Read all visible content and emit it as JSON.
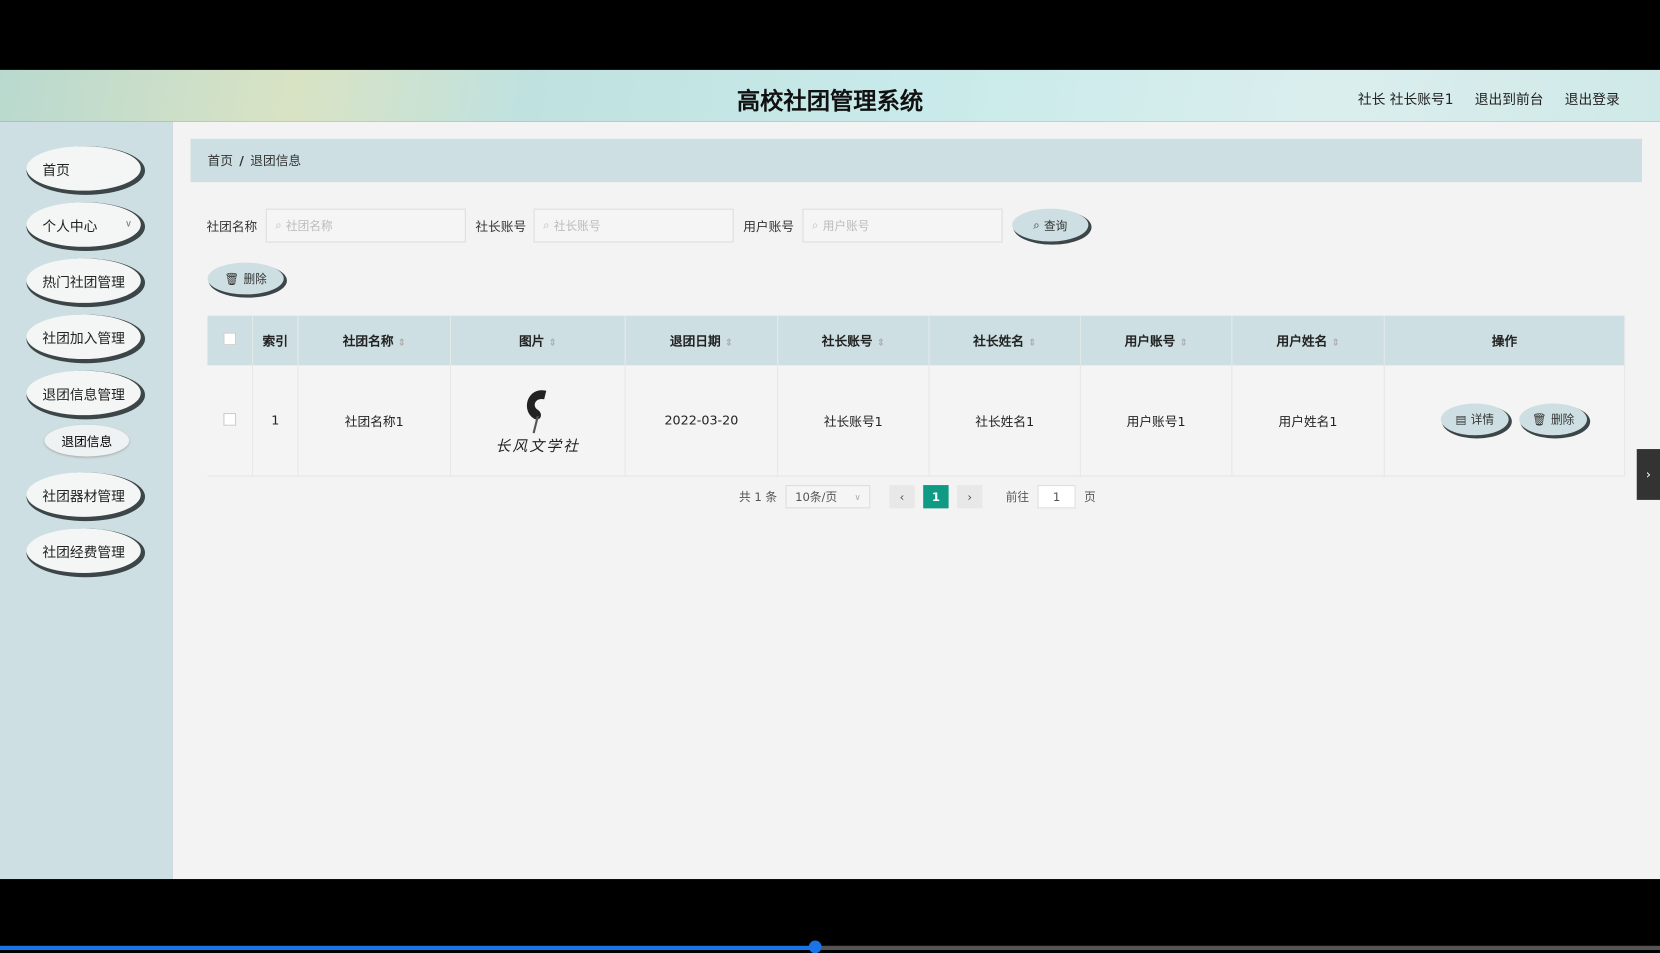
{
  "header": {
    "title": "高校社团管理系统",
    "user": "社长 社长账号1",
    "front": "退出到前台",
    "logout": "退出登录"
  },
  "sidebar": {
    "items": [
      "首页",
      "个人中心",
      "热门社团管理",
      "社团加入管理",
      "退团信息管理",
      "社团器材管理",
      "社团经费管理"
    ],
    "sub": "退团信息"
  },
  "breadcrumb": {
    "home": "首页",
    "sep": "/",
    "current": "退团信息"
  },
  "search": {
    "f1_label": "社团名称",
    "f1_ph": "社团名称",
    "f2_label": "社长账号",
    "f2_ph": "社长账号",
    "f3_label": "用户账号",
    "f3_ph": "用户账号",
    "query": "查询"
  },
  "toolbar": {
    "delete": "删除"
  },
  "table": {
    "headers": [
      "索引",
      "社团名称",
      "图片",
      "退团日期",
      "社长账号",
      "社长姓名",
      "用户账号",
      "用户姓名",
      "操作"
    ],
    "rows": [
      {
        "index": "1",
        "club": "社团名称1",
        "image_text": "长风文学社",
        "date": "2022-03-20",
        "leader_acc": "社长账号1",
        "leader_name": "社长姓名1",
        "user_acc": "用户账号1",
        "user_name": "用户姓名1",
        "detail": "详情",
        "delete": "删除"
      }
    ]
  },
  "pagination": {
    "total": "共 1 条",
    "size": "10条/页",
    "page": "1",
    "goto": "前往",
    "goto_val": "1",
    "page_unit": "页"
  },
  "colors": {
    "accent": "#0e9a83",
    "panel": "#cddfe2"
  }
}
